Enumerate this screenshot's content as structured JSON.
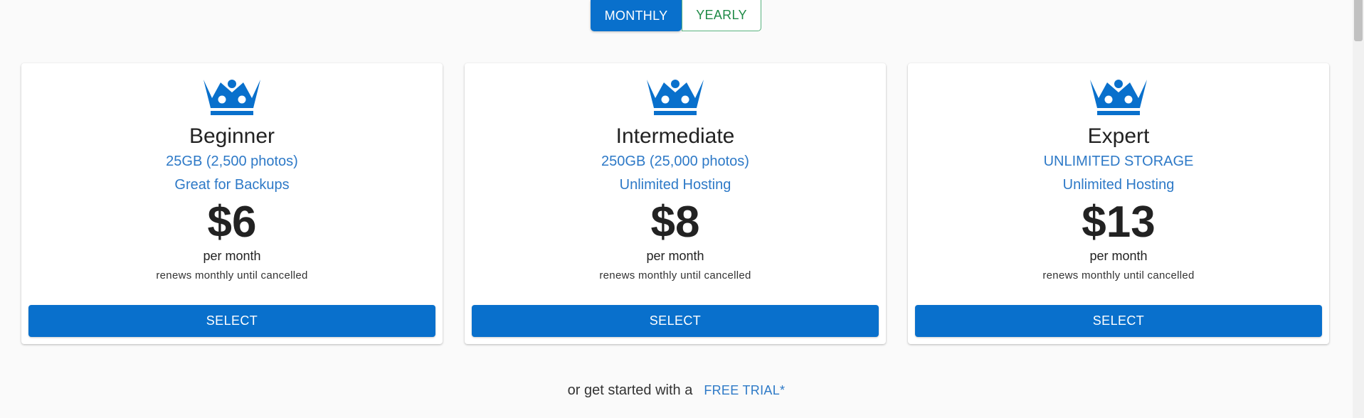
{
  "billing_toggle": {
    "options": [
      {
        "label": "MONTHLY",
        "active": true
      },
      {
        "label": "YEARLY",
        "active": false
      }
    ]
  },
  "plans": [
    {
      "icon": "crown-icon",
      "name": "Beginner",
      "storage": "25GB (2,500 photos)",
      "perk": "Great for Backups",
      "price": "$6",
      "period": "per month",
      "renewal": "renews monthly until cancelled",
      "button_label": "SELECT"
    },
    {
      "icon": "crown-icon",
      "name": "Intermediate",
      "storage": "250GB (25,000 photos)",
      "perk": "Unlimited Hosting",
      "price": "$8",
      "period": "per month",
      "renewal": "renews monthly until cancelled",
      "button_label": "SELECT"
    },
    {
      "icon": "crown-icon",
      "name": "Expert",
      "storage": "UNLIMITED STORAGE",
      "perk": "Unlimited Hosting",
      "price": "$13",
      "period": "per month",
      "renewal": "renews monthly until cancelled",
      "button_label": "SELECT"
    }
  ],
  "footer": {
    "text": "or get started with a",
    "link_label": "FREE TRIAL*"
  },
  "colors": {
    "primary": "#0970cc",
    "link": "#2d79c7",
    "yearly_green": "#1e8a46",
    "background": "#fafafa"
  }
}
